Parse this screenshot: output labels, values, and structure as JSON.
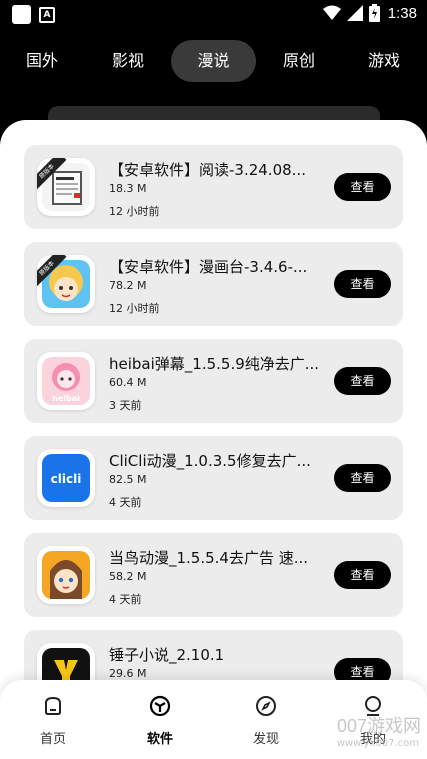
{
  "status_bar": {
    "time": "1:38"
  },
  "tabs": [
    {
      "label": "国外"
    },
    {
      "label": "影视"
    },
    {
      "label": "漫说",
      "active": true
    },
    {
      "label": "原创"
    },
    {
      "label": "游戏"
    }
  ],
  "apps": [
    {
      "title": "【安卓软件】阅读-3.24.08...",
      "size": "18.3 M",
      "time": "12 小时前",
      "button": "查看",
      "badge": "原版本",
      "icon": "book-reader-icon"
    },
    {
      "title": "【安卓软件】漫画台-3.4.6-...",
      "size": "78.2 M",
      "time": "12 小时前",
      "button": "查看",
      "badge": "原版本",
      "icon": "manga-girl-icon"
    },
    {
      "title": "heibai弹幕_1.5.5.9纯净去广...",
      "size": "60.4 M",
      "time": "3 天前",
      "button": "查看",
      "icon": "pink-anime-icon",
      "icon_text": "heibai"
    },
    {
      "title": "CliCli动漫_1.0.3.5修复去广...",
      "size": "82.5 M",
      "time": "4 天前",
      "button": "查看",
      "icon": "clicli-icon",
      "icon_text": "clicli"
    },
    {
      "title": "当鸟动漫_1.5.5.4去广告 速...",
      "size": "58.2 M",
      "time": "4 天前",
      "button": "查看",
      "icon": "bird-anime-icon"
    },
    {
      "title": "锤子小说_2.10.1",
      "size": "29.6 M",
      "time": "",
      "button": "查看",
      "icon": "hammer-novel-icon"
    }
  ],
  "bottom_nav": [
    {
      "label": "首页",
      "icon": "home-icon"
    },
    {
      "label": "软件",
      "icon": "software-cube-icon",
      "active": true
    },
    {
      "label": "发现",
      "icon": "compass-icon"
    },
    {
      "label": "我的",
      "icon": "profile-icon"
    }
  ],
  "watermark": {
    "text": "007游戏网",
    "url": "www.yx007.com"
  },
  "colors": {
    "card_bg": "#ececec",
    "button_bg": "#000000",
    "active_tab_bg": "#3a3a3a",
    "blue_icon": "#1a73e8"
  }
}
